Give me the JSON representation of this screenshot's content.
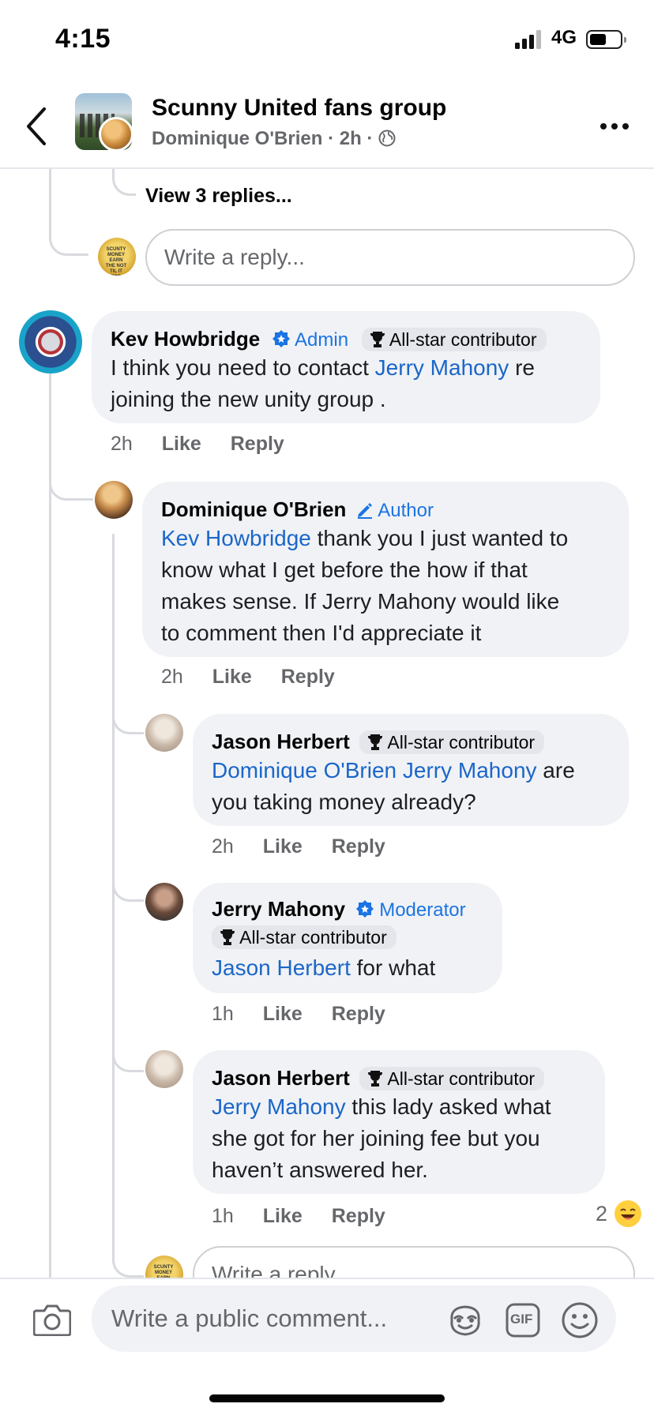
{
  "status_bar": {
    "time": "4:15",
    "network": "4G"
  },
  "header": {
    "title": "Scunny United fans group",
    "author": "Dominique O'Brien",
    "time_ago": "2h",
    "separator": "·"
  },
  "thread_top": {
    "view_replies": "View 3 replies...",
    "reply_placeholder": "Write a reply..."
  },
  "badges": {
    "admin": "Admin",
    "author": "Author",
    "moderator": "Moderator",
    "allstar": "All-star contributor"
  },
  "actions": {
    "like": "Like",
    "reply": "Reply"
  },
  "comments": [
    {
      "name": "Kev Howbridge",
      "line1_a": "I think you need to contact ",
      "line1_mention": "Jerry Mahony",
      "line1_b": " re",
      "line2": "joining the new unity group .",
      "time": "2h"
    },
    {
      "name": "Dominique O'Brien",
      "line1_mention": "Kev Howbridge",
      "line1_b": " thank you I just wanted to",
      "line2": "know what I get before the how if that",
      "line3": "makes sense. If Jerry Mahony would like",
      "line4": "to comment then I'd appreciate it",
      "time": "2h"
    },
    {
      "name": "Jason Herbert",
      "line1_mention": "Dominique O'Brien Jerry Mahony",
      "line1_b": " are",
      "line2": "you taking money already?",
      "time": "2h"
    },
    {
      "name": "Jerry Mahony",
      "line1_mention": "Jason Herbert",
      "line1_b": " for what",
      "time": "1h"
    },
    {
      "name": "Jason Herbert",
      "line1_mention": "Jerry Mahony",
      "line1_b": " this lady asked what",
      "line2": "she got for her joining fee but you",
      "line3": "haven’t answered her.",
      "time": "1h",
      "reaction_count": "2"
    }
  ],
  "bottom_reply_placeholder": "Write a reply...",
  "composer": {
    "placeholder": "Write a public comment...",
    "gif_label": "GIF"
  },
  "avatar_text": "SCUNTY MONEY EARN THE NOT TIL IT TOO",
  "colors": {
    "mention": "#1b66c9",
    "role_badge": "#1b74e4",
    "bubble": "#f0f2f5",
    "meta": "#65676b"
  }
}
